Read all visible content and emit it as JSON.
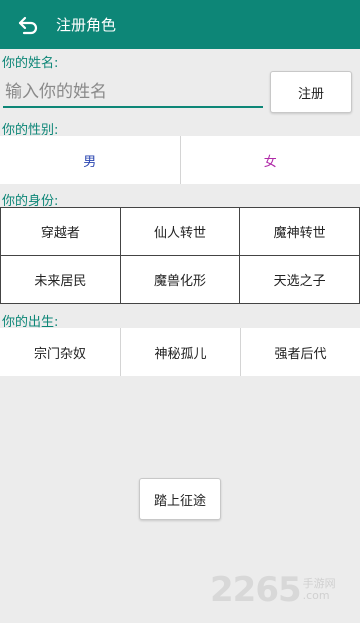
{
  "header": {
    "title": "注册角色",
    "back_icon": "back-arrow-icon"
  },
  "name_section": {
    "label": "你的姓名:",
    "placeholder": "输入你的姓名",
    "value": "",
    "register_label": "注册"
  },
  "gender_section": {
    "label": "你的性别:",
    "options": [
      "男",
      "女"
    ]
  },
  "identity_section": {
    "label": "你的身份:",
    "options": [
      "穿越者",
      "仙人转世",
      "魔神转世",
      "未来居民",
      "魔兽化形",
      "天选之子"
    ]
  },
  "birth_section": {
    "label": "你的出生:",
    "options": [
      "宗门杂奴",
      "神秘孤儿",
      "强者后代"
    ]
  },
  "start_button": {
    "label": "踏上征途"
  },
  "watermark": {
    "number": "2265",
    "suffix": "手游网",
    "domain": ".com"
  },
  "colors": {
    "accent": "#0d8677",
    "male": "#2a45b0",
    "female": "#b02aa8"
  }
}
